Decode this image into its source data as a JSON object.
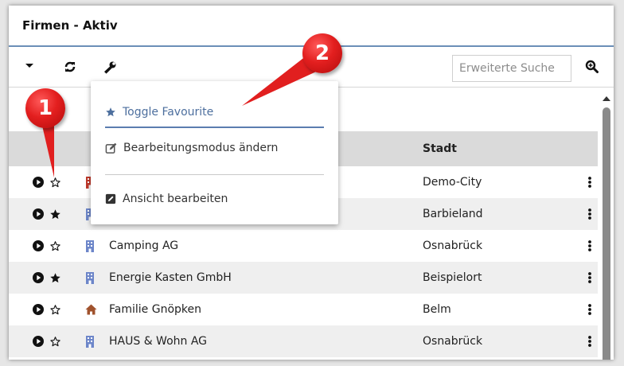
{
  "title": "Firmen - Aktiv",
  "search": {
    "placeholder": "Erweiterte Suche"
  },
  "table": {
    "column_city": "Stadt",
    "rows": [
      {
        "name": "",
        "city": "Demo-City",
        "favourite": false,
        "type": "company",
        "type_color": "#c0392b"
      },
      {
        "name": "",
        "city": "Barbieland",
        "favourite": true,
        "type": "company",
        "type_color": "#6d86c9"
      },
      {
        "name": "Camping AG",
        "city": "Osnabrück",
        "favourite": false,
        "type": "company",
        "type_color": "#6d86c9"
      },
      {
        "name": "Energie Kasten GmbH",
        "city": "Beispielort",
        "favourite": true,
        "type": "company",
        "type_color": "#6d86c9"
      },
      {
        "name": "Familie Gnöpken",
        "city": "Belm",
        "favourite": false,
        "type": "household",
        "type_color": "#a0522d"
      },
      {
        "name": "HAUS & Wohn AG",
        "city": "Osnabrück",
        "favourite": false,
        "type": "company",
        "type_color": "#6d86c9"
      }
    ]
  },
  "menu": {
    "toggle_favourite": "Toggle Favourite",
    "edit_mode": "Bearbeitungsmodus ändern",
    "edit_view": "Ansicht bearbeiten"
  },
  "annotations": {
    "badge_1": "1",
    "badge_2": "2"
  },
  "colors": {
    "accent": "#4d6f9e",
    "badge": "#e31f1f"
  }
}
